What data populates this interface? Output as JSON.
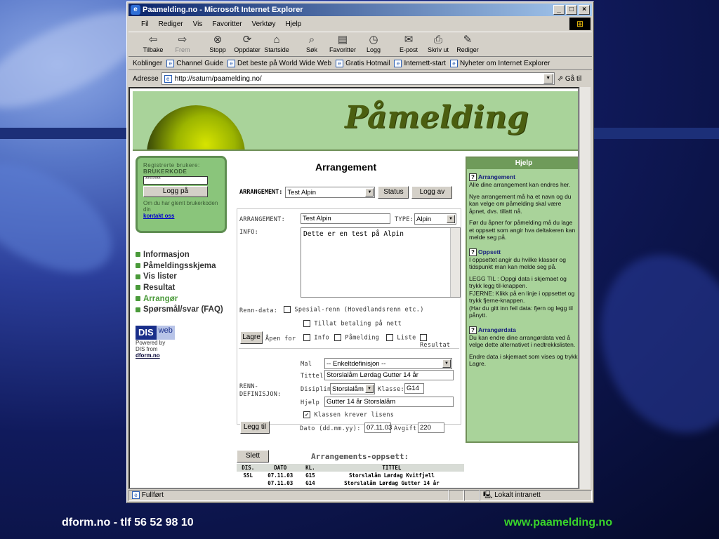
{
  "window": {
    "title": "Paamelding.no - Microsoft Internet Explorer",
    "menus": [
      "Fil",
      "Rediger",
      "Vis",
      "Favoritter",
      "Verktøy",
      "Hjelp"
    ],
    "toolbar": {
      "back": "Tilbake",
      "forward": "Frem",
      "stop": "Stopp",
      "refresh": "Oppdater",
      "home": "Startside",
      "search": "Søk",
      "favorites": "Favoritter",
      "history": "Logg",
      "mail": "E-post",
      "print": "Skriv ut",
      "edit": "Rediger"
    },
    "links": {
      "label": "Koblinger",
      "items": [
        "Channel Guide",
        "Det beste på World Wide Web",
        "Gratis Hotmail",
        "Internett-start",
        "Nyheter om Internet Explorer"
      ]
    },
    "address": {
      "label": "Adresse",
      "url": "http://saturn/paamelding.no/",
      "go": "Gå til"
    },
    "status": {
      "left": "Fullført",
      "zone": "Lokalt intranett"
    }
  },
  "page": {
    "banner_title": "Påmelding",
    "login": {
      "registered_label": "Registrerte brukere:",
      "code_label": "BRUKERKODE",
      "password_value": "********",
      "button": "Logg på",
      "forgot_text": "Om du har glemt brukerkoden din",
      "contact_link": "kontakt oss"
    },
    "nav": [
      "Informasjon",
      "Påmeldingsskjema",
      "Vis lister",
      "Resultat",
      "Arrangør",
      "Spørsmål/svar (FAQ)"
    ],
    "dis": {
      "logo_a": "DIS",
      "logo_b": "web",
      "powered": "Powered by",
      "from": "DIS from",
      "link": "dform.no"
    },
    "heading": "Arrangement",
    "arrangement_row": {
      "label": "ARRANGEMENT:",
      "selected": "Test Alpin",
      "status_btn": "Status",
      "logout_btn": "Logg av"
    },
    "form": {
      "arr_label": "ARRANGEMENT:",
      "arr_value": "Test Alpin",
      "type_label": "TYPE:",
      "type_value": "Alpin",
      "info_label": "INFO:",
      "info_value": "Dette er en test på Alpin",
      "renn_data_label": "Renn-data:",
      "spesial_renn": "Spesial-renn (Hovedlandsrenn etc.)",
      "tillat_betaling": "Tillat betaling på nett",
      "lagre_btn": "Lagre",
      "apen_for": "Åpen for",
      "open_opts": [
        "Info",
        "Påmelding",
        "Liste",
        "Resultat"
      ],
      "renn_def_label": "RENN-\nDEFINISJON:",
      "mal_label": "Mal",
      "mal_value": "-- Enkeltdefinisjon --",
      "tittel_label": "Tittel",
      "tittel_value": "Storslalåm Lørdag Gutter 14 år",
      "disiplin_label": "Disiplin:",
      "disiplin_value": "Storslalåm",
      "klasse_label": "Klasse:",
      "klasse_value": "G14",
      "hjelp_label": "Hjelp",
      "hjelp_value": "Gutter 14 år Storslalåm",
      "krever_lisens": "Klassen krever lisens",
      "legg_til_btn": "Legg til",
      "dato_label": "Dato (dd.mm.yy):",
      "dato_value": "07.11.03",
      "avgift_label": "Avgift:",
      "avgift_value": "220"
    },
    "help": {
      "header": "Hjelp",
      "sections": [
        {
          "title": "Arrangement",
          "paras": [
            "Alle dine arrangement kan endres her.",
            "Nye arrangement må ha et navn og du kan velge om påmelding skal være åpnet, dvs. tillatt nå.",
            "Før du åpner for påmelding må du lage et oppsett som angir hva deltakeren kan melde seg på."
          ]
        },
        {
          "title": "Oppsett",
          "paras": [
            "I oppsettet angir du hvilke klasser og tidspunkt man kan melde seg på.",
            "LEGG TIL : Oppgi data i skjemaet og trykk legg til-knappen.\nFJERNE: Klikk på en linje i oppsettet og trykk fjerne-knappen.\n(Har du gitt inn feil data: fjern og legg til pånytt."
          ]
        },
        {
          "title": "Arrangørdata",
          "paras": [
            "Du kan endre dine arrangørdata ved å velge dette alternativet i nedtrekkslisten.",
            "Endre data i skjemaet som vises og trykk Lagre."
          ]
        }
      ]
    },
    "oppsett": {
      "slett_btn": "Slett",
      "title": "Arrangements-oppsett:",
      "columns": [
        "DIS.",
        "DATO",
        "KL.",
        "TITTEL"
      ],
      "rows": [
        [
          "SSL",
          "07.11.03",
          "G15",
          "Storslalåm Lørdag Kvitfjell"
        ],
        [
          "",
          "07.11.03",
          "G14",
          "Storslalåm Lørdag Gutter 14 år"
        ]
      ]
    }
  },
  "footer": {
    "left": "dform.no - tlf 56 52 98 10",
    "right": "www.paamelding.no"
  },
  "colors": {
    "accent_green": "#a9d39a",
    "footer_link": "#39d42a"
  }
}
